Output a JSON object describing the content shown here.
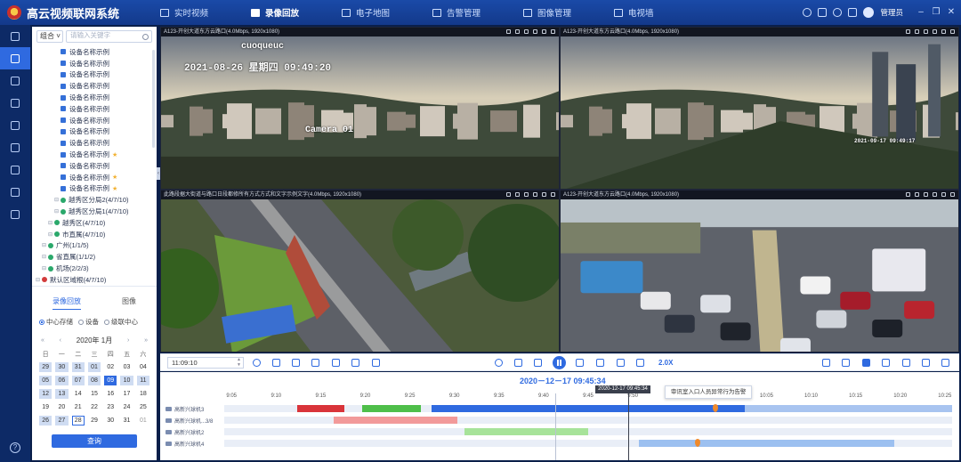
{
  "app": {
    "title": "高云视频联网系统"
  },
  "nav": [
    {
      "label": "实时视频",
      "active": false
    },
    {
      "label": "录像回放",
      "active": true
    },
    {
      "label": "电子地图",
      "active": false
    },
    {
      "label": "告警管理",
      "active": false
    },
    {
      "label": "图像管理",
      "active": false
    },
    {
      "label": "电视墙",
      "active": false
    }
  ],
  "header": {
    "user": "管理员"
  },
  "rail": {
    "items": [
      "menu",
      "playback",
      "favorites",
      "devices",
      "alarms",
      "images",
      "docs",
      "layout",
      "settings"
    ],
    "active_index": 1
  },
  "search": {
    "scope": "组合",
    "placeholder": "请输入关键字"
  },
  "tree": {
    "nodes": [
      {
        "label": "默认区域根(4/7/10)",
        "level": 0,
        "kind": "root"
      },
      {
        "label": "机场(2/2/3)",
        "level": 1,
        "kind": "area"
      },
      {
        "label": "省直属(1/1/2)",
        "level": 1,
        "kind": "area"
      },
      {
        "label": "广州(1/1/5)",
        "level": 1,
        "kind": "area"
      },
      {
        "label": "市直属(4/7/10)",
        "level": 2,
        "kind": "area"
      },
      {
        "label": "越秀区(4/7/10)",
        "level": 2,
        "kind": "area"
      },
      {
        "label": "越秀区分局1(4/7/10)",
        "level": 3,
        "kind": "area"
      },
      {
        "label": "越秀区分局2(4/7/10)",
        "level": 3,
        "kind": "area"
      },
      {
        "label": "设备名称示例",
        "level": 4,
        "kind": "cam",
        "star": true
      },
      {
        "label": "设备名称示例",
        "level": 4,
        "kind": "cam",
        "star": true
      },
      {
        "label": "设备名称示例",
        "level": 4,
        "kind": "cam"
      },
      {
        "label": "设备名称示例",
        "level": 4,
        "kind": "cam",
        "star": true
      },
      {
        "label": "设备名称示例",
        "level": 4,
        "kind": "cam"
      },
      {
        "label": "设备名称示例",
        "level": 4,
        "kind": "cam"
      },
      {
        "label": "设备名称示例",
        "level": 4,
        "kind": "cam"
      },
      {
        "label": "设备名称示例",
        "level": 4,
        "kind": "cam"
      },
      {
        "label": "设备名称示例",
        "level": 4,
        "kind": "cam"
      },
      {
        "label": "设备名称示例",
        "level": 4,
        "kind": "cam"
      },
      {
        "label": "设备名称示例",
        "level": 4,
        "kind": "cam"
      },
      {
        "label": "设备名称示例",
        "level": 4,
        "kind": "cam"
      },
      {
        "label": "设备名称示例",
        "level": 4,
        "kind": "cam"
      }
    ]
  },
  "tabs": {
    "items": [
      "录像回放",
      "图像"
    ],
    "active_index": 0
  },
  "source_radios": {
    "items": [
      "中心存储",
      "设备",
      "级联中心"
    ],
    "selected_index": 0
  },
  "calendar": {
    "title": "2020年 1月",
    "prev_year": "«",
    "prev_month": "‹",
    "next_month": "›",
    "next_year": "»",
    "weekdays": [
      "日",
      "一",
      "二",
      "三",
      "四",
      "五",
      "六"
    ],
    "days": [
      {
        "d": "29",
        "s": "rec"
      },
      {
        "d": "30",
        "s": "rec"
      },
      {
        "d": "31",
        "s": "rec"
      },
      {
        "d": "01",
        "s": "rec"
      },
      {
        "d": "02",
        "s": ""
      },
      {
        "d": "03",
        "s": ""
      },
      {
        "d": "04",
        "s": ""
      },
      {
        "d": "05",
        "s": "rec"
      },
      {
        "d": "06",
        "s": "rec"
      },
      {
        "d": "07",
        "s": "rec"
      },
      {
        "d": "08",
        "s": "rec"
      },
      {
        "d": "09",
        "s": "sel"
      },
      {
        "d": "10",
        "s": "rec"
      },
      {
        "d": "11",
        "s": "rec"
      },
      {
        "d": "12",
        "s": "rec"
      },
      {
        "d": "13",
        "s": "rec"
      },
      {
        "d": "14",
        "s": ""
      },
      {
        "d": "15",
        "s": ""
      },
      {
        "d": "16",
        "s": ""
      },
      {
        "d": "17",
        "s": ""
      },
      {
        "d": "18",
        "s": ""
      },
      {
        "d": "19",
        "s": ""
      },
      {
        "d": "20",
        "s": ""
      },
      {
        "d": "21",
        "s": ""
      },
      {
        "d": "22",
        "s": ""
      },
      {
        "d": "23",
        "s": ""
      },
      {
        "d": "24",
        "s": ""
      },
      {
        "d": "25",
        "s": ""
      },
      {
        "d": "26",
        "s": "rec"
      },
      {
        "d": "27",
        "s": "rec"
      },
      {
        "d": "28",
        "s": "today"
      },
      {
        "d": "29",
        "s": ""
      },
      {
        "d": "30",
        "s": ""
      },
      {
        "d": "31",
        "s": ""
      },
      {
        "d": "01",
        "s": "dim"
      }
    ]
  },
  "query_button": "查询",
  "video": {
    "tiles": [
      {
        "title": "A123-开创大道东方云路口(4.0Mbps, 1920x1080)",
        "osd_date": "2021-08-26 星期四 09:49:20",
        "osd_top": "cuoqueuc",
        "osd_cam": "Camera 01",
        "scene": "city"
      },
      {
        "title": "A123-开创大道东方云路口(4.0Mbps, 1920x1080)",
        "osd_side": "2021-09-17 09:49:17",
        "scene": "city2"
      },
      {
        "title": "此路段据大街道与路口日段都修所有方式方式和文字示例文字(4.0Mbps, 1920x1080)",
        "scene": "aerial"
      },
      {
        "title": "A123-开创大道东方云路口(4.0Mbps, 1920x1080)",
        "scene": "road"
      }
    ]
  },
  "playback": {
    "time": "11:09:10",
    "speed": "2.0X"
  },
  "timeline": {
    "date": "2020－12－17 09:45:34",
    "cursor_label": "2020-12-17 09:45:34",
    "tooltip": "审讯室入口人员异常行为告警",
    "ticks": [
      "9:05",
      "9:10",
      "9:15",
      "9:20",
      "9:25",
      "9:30",
      "9:35",
      "9:40",
      "9:45",
      "9:50",
      "9:55",
      "10:00",
      "10:05",
      "10:10",
      "10:15",
      "10:20",
      "10:25"
    ],
    "rows": [
      {
        "label": "高新兴球机3",
        "segments": [
          {
            "start": 0.1,
            "end": 0.165,
            "color": "#d9343a"
          },
          {
            "start": 0.19,
            "end": 0.27,
            "color": "#4fbf4a"
          },
          {
            "start": 0.285,
            "end": 0.715,
            "color": "#2f6ae0"
          },
          {
            "start": 0.715,
            "end": 1.0,
            "color": "#a8c4f0"
          }
        ],
        "markers": [
          0.675
        ]
      },
      {
        "label": "高新兴球机...3/8",
        "segments": [
          {
            "start": 0.15,
            "end": 0.32,
            "color": "#f29a9a"
          }
        ],
        "markers": []
      },
      {
        "label": "高新兴球机2",
        "segments": [
          {
            "start": 0.33,
            "end": 0.5,
            "color": "#a7e39a"
          }
        ],
        "markers": []
      },
      {
        "label": "高新兴球机4",
        "segments": [
          {
            "start": 0.57,
            "end": 0.92,
            "color": "#9cc0f0"
          }
        ],
        "markers": [
          0.65
        ]
      }
    ]
  }
}
